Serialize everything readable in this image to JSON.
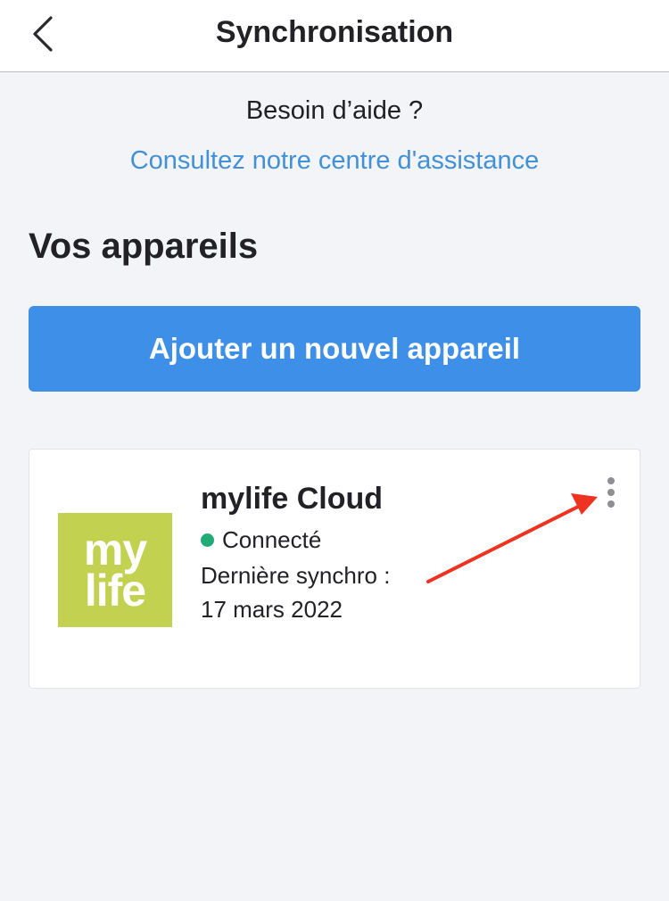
{
  "header": {
    "title": "Synchronisation",
    "back_icon": "chevron-left-icon"
  },
  "help": {
    "title": "Besoin d’aide ?",
    "link": "Consultez notre centre d'assistance"
  },
  "devices_section": {
    "title": "Vos appareils",
    "add_button_label": "Ajouter un nouvel appareil"
  },
  "device": {
    "logo_line1": "my",
    "logo_line2": "life",
    "name": "mylife Cloud",
    "status": "Connecté",
    "sync_label": "Dernière synchro :",
    "sync_date": "17 mars 2022",
    "menu_icon": "more-vertical-icon"
  },
  "colors": {
    "accent": "#3d8fe8",
    "link": "#4291d6",
    "status_connected": "#22aa77",
    "logo_background": "#c3d150",
    "annotation_arrow": "#ee3322"
  }
}
